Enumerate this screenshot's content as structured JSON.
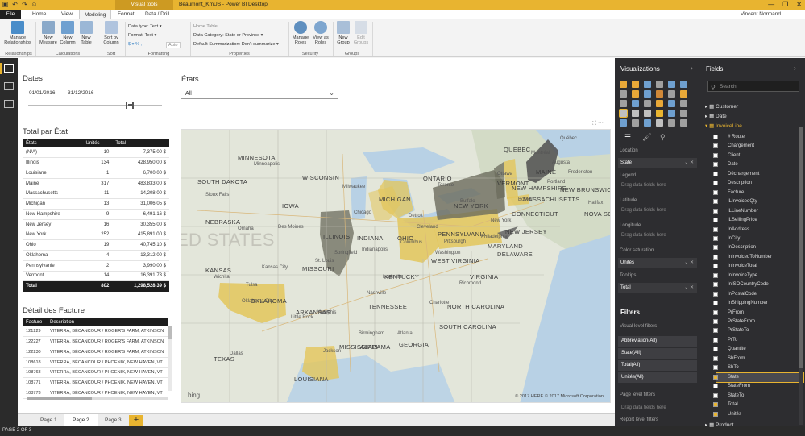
{
  "window": {
    "title": "Beaumont_KmUS - Power BI Desktop",
    "context_tab": "Visual tools",
    "user": "Vincent Normand",
    "controls": [
      "—",
      "❐",
      "✕"
    ]
  },
  "tabs": [
    "File",
    "Home",
    "View",
    "Modeling",
    "Format",
    "Data / Drill"
  ],
  "ribbon": {
    "manage_relationships": "Manage Relationships",
    "new_measure": "New Measure",
    "new_column": "New Column",
    "new_table": "New Table",
    "sort_by_column": "Sort by Column",
    "data_type": "Data type: Text ▾",
    "format": "Format: Text ▾",
    "currency": "$ ▾ % ,",
    "decimals": "Auto",
    "home_table": "Home Table:",
    "data_category": "Data Category: State or Province ▾",
    "default_summarization": "Default Summarization: Don't summarize ▾",
    "manage_roles": "Manage Roles",
    "view_as_roles": "View as Roles",
    "new_group": "New Group",
    "edit_groups": "Edit Groups",
    "groups": {
      "relationships": "Relationships",
      "calculations": "Calculations",
      "sort": "Sort",
      "formatting": "Formatting",
      "properties": "Properties",
      "security": "Security",
      "groups": "Groups"
    }
  },
  "dates": {
    "title": "Dates",
    "from": "01/01/2016",
    "to": "31/12/2016"
  },
  "etats": {
    "title": "États",
    "selected": "All"
  },
  "total_par_etat": {
    "title": "Total par État",
    "headers": [
      "États",
      "Unités",
      "Total"
    ],
    "rows": [
      [
        "(N/A)",
        "10",
        "7,375.00 $"
      ],
      [
        "Illinois",
        "134",
        "428,950.00 $"
      ],
      [
        "Louisiane",
        "1",
        "6,700.00 $"
      ],
      [
        "Maine",
        "317",
        "483,833.00 $"
      ],
      [
        "Massachusetts",
        "11",
        "14,208.00 $"
      ],
      [
        "Michigan",
        "13",
        "31,006.05 $"
      ],
      [
        "New Hampshire",
        "9",
        "6,491.16 $"
      ],
      [
        "New Jersey",
        "16",
        "30,355.00 $"
      ],
      [
        "New York",
        "252",
        "415,891.00 $"
      ],
      [
        "Ohio",
        "19",
        "40,745.10 $"
      ],
      [
        "Oklahoma",
        "4",
        "13,312.00 $"
      ],
      [
        "Pennsylvanie",
        "2",
        "3,990.00 $"
      ],
      [
        "Vermont",
        "14",
        "16,391.73 $"
      ]
    ],
    "total": [
      "Total",
      "802",
      "1,298,528.39 $"
    ]
  },
  "detail": {
    "title": "Détail des Facture",
    "headers": [
      "Facture",
      "Description"
    ],
    "rows": [
      [
        "121229",
        "VITERRA, BÉCANCOUR / ROGER'S FARM, ATKINSON"
      ],
      [
        "122227",
        "VITERRA, BÉCANCOUR / ROGER'S FARM, ATKINSON"
      ],
      [
        "122230",
        "VITERRA, BÉCANCOUR / ROGER'S FARM, ATKINSON"
      ],
      [
        "108618",
        "VITERRA, BÉCANCOUR / PHOENIX, NEW HAVEN, VT"
      ],
      [
        "108768",
        "VITERRA, BÉCANCOUR / PHOENIX, NEW HAVEN, VT"
      ],
      [
        "108771",
        "VITERRA, BÉCANCOUR / PHOENIX, NEW HAVEN, VT"
      ],
      [
        "108773",
        "VITERRA, BÉCANCOUR / PHOENIX, NEW HAVEN, VT"
      ]
    ]
  },
  "map": {
    "labels": [
      "WISCONSIN",
      "MICHIGAN",
      "ILLINOIS",
      "INDIANA",
      "OHIO",
      "PENNSYLVANIA",
      "NEW YORK",
      "MAINE",
      "VERMONT",
      "NEW HAMPSHIRE",
      "MASSACHUSETTS",
      "CONNECTICUT",
      "KENTUCKY",
      "VIRGINIA",
      "TENNESSEE",
      "NORTH CAROLINA",
      "OKLAHOMA",
      "ARKANSAS",
      "MISSISSIPPI",
      "ALABAMA",
      "GEORGIA",
      "MISSOURI",
      "IOWA",
      "ONTARIO",
      "QUEBEC",
      "NEW BRUNSWICK",
      "NOVA SCOTIA",
      "MINNESOTA",
      "KANSAS",
      "TEXAS",
      "LOUISIANA",
      "SOUTH CAROLINA",
      "WEST VIRGINIA",
      "MARYLAND",
      "NEW JERSEY",
      "DELAWARE",
      "NEBRASKA",
      "SOUTH DAKOTA"
    ],
    "cities": [
      "Chicago",
      "Detroit",
      "Toronto",
      "Montréal",
      "Ottawa",
      "Québec",
      "Boston",
      "New York",
      "Philadelphia",
      "Washington",
      "Columbus",
      "Indianapolis",
      "Louisville",
      "Nashville",
      "Atlanta",
      "Memphis",
      "St. Louis",
      "Kansas City",
      "Omaha",
      "Des Moines",
      "Minneapolis",
      "Milwaukee",
      "Cleveland",
      "Pittsburgh",
      "Richmond",
      "Charlotte",
      "Birmingham",
      "Jackson",
      "Little Rock",
      "Tulsa",
      "Oklahoma City",
      "Wichita",
      "Dallas",
      "Sioux Falls",
      "Springfield",
      "Augusta",
      "Fredericton",
      "Halifax",
      "Portland",
      "Buffalo"
    ],
    "watermark": "ED STATES",
    "copyright": "© 2017 HERE   © 2017 Microsoft Corporation",
    "bing": "bing"
  },
  "pages": [
    "Page 1",
    "Page 2",
    "Page 3"
  ],
  "add_page": "+",
  "status": "PAGE 2 OF 3",
  "visualizations": {
    "title": "Visualizations",
    "wells": [
      {
        "label": "Location",
        "value": "State"
      },
      {
        "label": "Legend",
        "value": "Drag data fields here"
      },
      {
        "label": "Latitude",
        "value": "Drag data fields here"
      },
      {
        "label": "Longitude",
        "value": "Drag data fields here"
      },
      {
        "label": "Color saturation",
        "value": "Unités"
      },
      {
        "label": "Tooltips",
        "value": "Total"
      }
    ],
    "filters_title": "Filters",
    "visual_level": "Visual level filters",
    "filters": [
      "Abbreviation(All)",
      "State(All)",
      "Total(All)",
      "Unités(All)"
    ],
    "page_level": "Page level filters",
    "report_level": "Report level filters",
    "drag": "Drag data fields here"
  },
  "fields": {
    "title": "Fields",
    "search_placeholder": "Search",
    "tables": [
      "Customer",
      "Date",
      "InvoiceLine"
    ],
    "items": [
      "# Route",
      "Chargement",
      "Client",
      "Date",
      "Déchargement",
      "Description",
      "Facture",
      "ILInvoicedQty",
      "ILLineNumber",
      "ILSellingPrice",
      "InAddress",
      "InCity",
      "InDescription",
      "InInvoicedToNumber",
      "InInvoiceTotal",
      "InInvoiceType",
      "InISOCountryCode",
      "InPostalCode",
      "InShippingNumber",
      "PrFrom",
      "PrStateFrom",
      "PrStateTo",
      "PrTo",
      "Quantité",
      "ShFrom",
      "ShTo",
      "State",
      "StateFrom",
      "StateTo",
      "Total",
      "Unités"
    ],
    "last_table": "Product"
  },
  "colors": {
    "accent": "#e8b430",
    "dark": "#2b2b2b",
    "fill_light": "#e3c55a",
    "fill_dark": "#6b6b5c"
  }
}
